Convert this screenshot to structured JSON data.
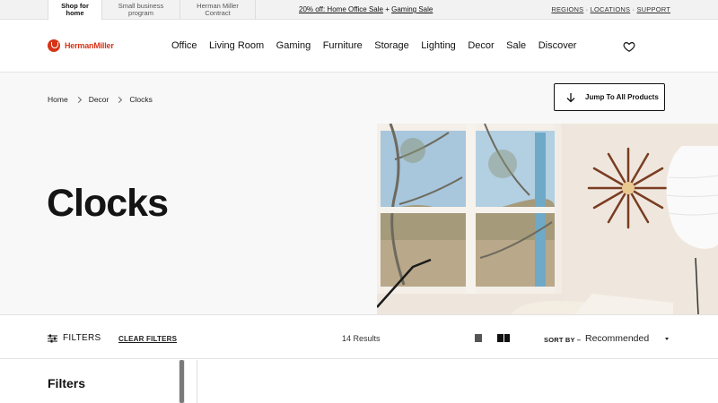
{
  "topbar": {
    "segments": [
      {
        "label": "Shop for home",
        "active": true
      },
      {
        "label": "Small business program",
        "active": false
      },
      {
        "label": "Herman Miller Contract",
        "active": false
      }
    ],
    "promo_main": "20% off: Home Office Sale",
    "promo_sep": " + ",
    "promo_second": "Gaming Sale",
    "utility_links": [
      "REGIONS",
      "LOCATIONS",
      "SUPPORT"
    ],
    "utility_sep": " · "
  },
  "header": {
    "logo_text": "HermanMiller",
    "nav_items": [
      "Office",
      "Living Room",
      "Gaming",
      "Furniture",
      "Storage",
      "Lighting",
      "Decor",
      "Sale",
      "Discover"
    ],
    "wishlist_icon": "heart-icon"
  },
  "breadcrumb": [
    "Home",
    "Decor",
    "Clocks"
  ],
  "jump_button": "Jump To All Products",
  "page_title": "Clocks",
  "toolbar": {
    "filters_label": "FILTERS",
    "clear_filters_label": "CLEAR FILTERS",
    "results": "14 Results",
    "sort_label": "SORT BY –",
    "sort_value": "Recommended"
  },
  "sidebar": {
    "heading": "Filters"
  },
  "colors": {
    "brand": "#d63518",
    "text": "#1a1a1a",
    "hero_bg": "#f8f8f8"
  }
}
